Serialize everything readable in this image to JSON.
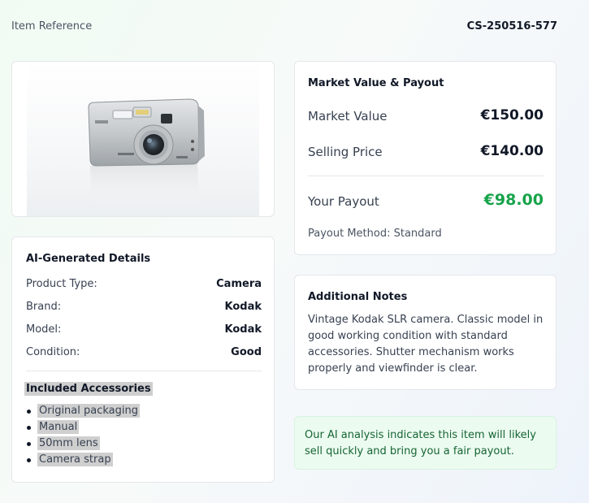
{
  "header": {
    "reference_label": "Item Reference",
    "reference_value": "CS-250516-577"
  },
  "photo": {
    "alt": "Silver Kodak digital camera"
  },
  "details": {
    "title": "AI-Generated Details",
    "rows": [
      {
        "label": "Product Type:",
        "value": "Camera"
      },
      {
        "label": "Brand:",
        "value": "Kodak"
      },
      {
        "label": "Model:",
        "value": "Kodak"
      },
      {
        "label": "Condition:",
        "value": "Good"
      }
    ],
    "accessories_title": "Included Accessories",
    "accessories": [
      "Original packaging",
      "Manual",
      "50mm lens",
      "Camera strap"
    ]
  },
  "payout": {
    "title": "Market Value & Payout",
    "market_value_label": "Market Value",
    "market_value": "€150.00",
    "selling_price_label": "Selling Price",
    "selling_price": "€140.00",
    "your_payout_label": "Your Payout",
    "your_payout": "€98.00",
    "method": "Payout Method: Standard"
  },
  "notes": {
    "title": "Additional Notes",
    "text": "Vintage Kodak SLR camera. Classic model in good working condition with standard accessories. Shutter mechanism works properly and viewfinder is clear."
  },
  "ai_banner": {
    "text": "Our AI analysis indicates this item will likely sell quickly and bring you a fair payout."
  },
  "colors": {
    "accent_green": "#16a34a",
    "banner_bg": "#ecfbf0",
    "highlight": "#cfcfcf"
  }
}
